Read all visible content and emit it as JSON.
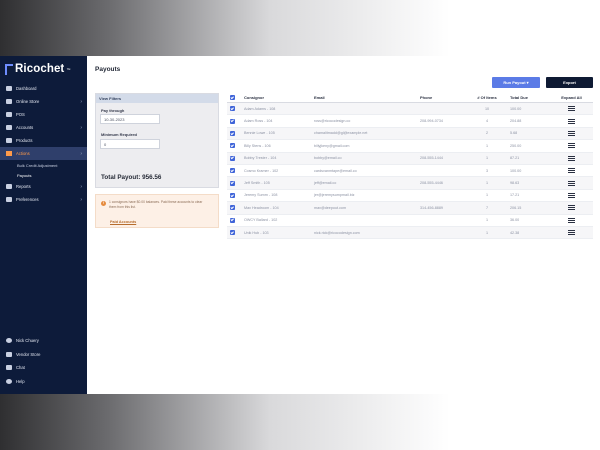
{
  "app": {
    "logo": "Ricochet",
    "logo_tm": "™"
  },
  "sidebar": {
    "items": [
      {
        "label": "Dashboard",
        "icon": "home-icon",
        "chevron": ""
      },
      {
        "label": "Online Store",
        "icon": "monitor-icon",
        "chevron": "›"
      },
      {
        "label": "POS",
        "icon": "register-icon",
        "chevron": ""
      },
      {
        "label": "Accounts",
        "icon": "users-icon",
        "chevron": "›"
      },
      {
        "label": "Products",
        "icon": "box-icon",
        "chevron": ""
      },
      {
        "label": "Actions",
        "icon": "bolt-icon",
        "chevron": "›",
        "active": true
      }
    ],
    "sub_items": [
      "Bulk Credit Adjustment",
      "Payouts"
    ],
    "items_after": [
      {
        "label": "Reports",
        "icon": "chart-icon",
        "chevron": "›"
      },
      {
        "label": "Preferences",
        "icon": "gear-icon",
        "chevron": "›"
      }
    ],
    "bottom": [
      {
        "label": "Nick Chuery",
        "icon": "user-icon"
      },
      {
        "label": "Vendor Store",
        "icon": "store-icon"
      },
      {
        "label": "Chat",
        "icon": "chat-icon"
      },
      {
        "label": "Help",
        "icon": "help-icon"
      }
    ]
  },
  "page": {
    "title": "Payouts"
  },
  "filters": {
    "header": "View Filters",
    "pay_through_label": "Pay through",
    "pay_through_value": "10-30-2023",
    "minimum_label": "Minimum Required",
    "minimum_value": "0",
    "total_label": "Total Payout: 956.56"
  },
  "warning": {
    "text": "1 consignors have $0.00 balances. Paid these accounts to clear them from this list.",
    "link": "Paid Accounts"
  },
  "toolbar": {
    "run_payout": "Run Payout ▾",
    "export": "Export"
  },
  "table": {
    "headers": [
      "Consignor",
      "Email",
      "Phone",
      "# Of Items",
      "Total Due",
      "Expand All"
    ],
    "rows": [
      [
        "Adam Adams - 108",
        "",
        "",
        "10",
        "100.00"
      ],
      [
        "Adam Ross - 104",
        "ross@ricocodesign.co",
        "208-994-0734",
        "4",
        "204.88"
      ],
      [
        "Bennie Lowe - 105",
        "chamalitmadd@gl@example.net",
        "",
        "2",
        "5.68"
      ],
      [
        "Billy Stens - 106",
        "billyjkeny@gmail.com",
        "",
        "1",
        "250.00"
      ],
      [
        "Bobby Trester - 104",
        "bobby@email.co",
        "208-555-1444",
        "1",
        "87.21"
      ],
      [
        "Cosmo Kramer - 102",
        "cardsvanmtape@email.co",
        "",
        "3",
        "100.00"
      ],
      [
        "Jeff Smith - 105",
        "jeff@email.co",
        "208-555-4446",
        "1",
        "98.63"
      ],
      [
        "Jeremy Sumrn - 108",
        "jer@jeremysumpmail.biz",
        "",
        "1",
        "17.21"
      ],
      [
        "Max Headroom - 104",
        "max@deepout.com",
        "314-456-8889",
        "7",
        "206.15"
      ],
      [
        "OWCY Ballard - 102",
        "",
        "",
        "1",
        "36.00"
      ],
      [
        "Unik Hub - 103",
        "nick.rick@ricocodesign.com",
        "",
        "1",
        "42.38"
      ]
    ]
  },
  "colors": {
    "sidebar": "#0d1b3a",
    "accent": "#5b7be6",
    "active": "#ff9a4a"
  }
}
